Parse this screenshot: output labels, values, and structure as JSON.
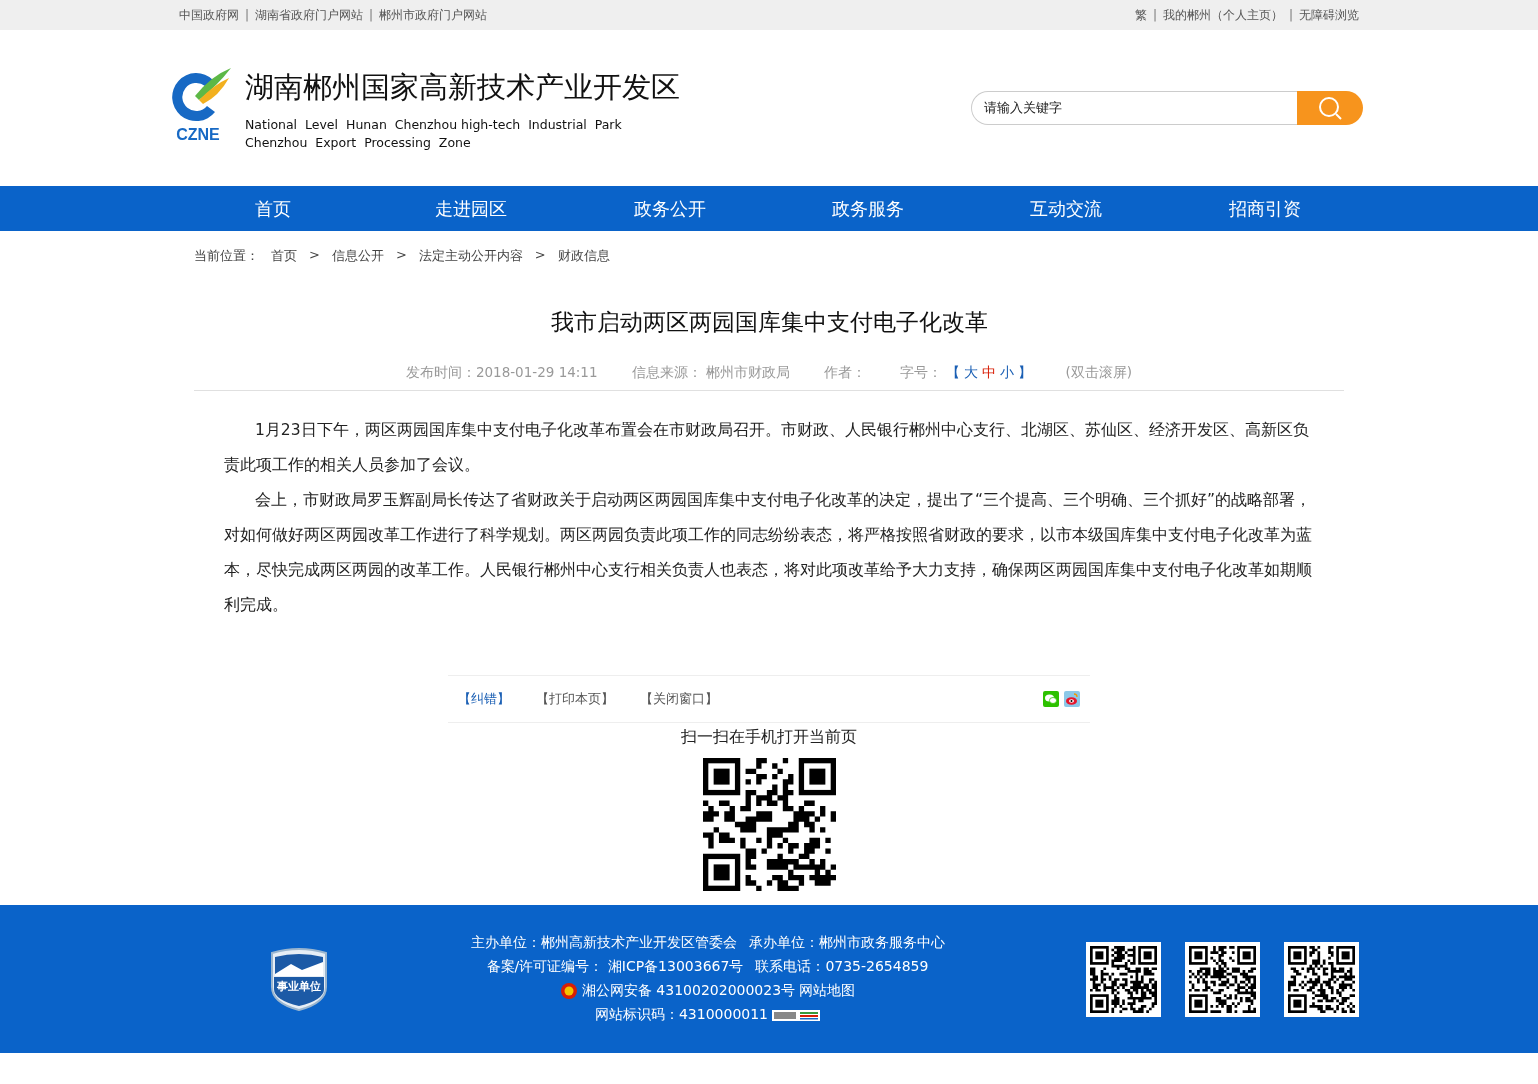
{
  "top_bar": {
    "separator": "|",
    "left_links": [
      "中国政府网",
      "湖南省政府门户网站",
      "郴州市政府门户网站"
    ],
    "right_links": [
      "繁",
      "我的郴州（个人主页）",
      "无障碍浏览"
    ]
  },
  "header": {
    "logo_text": "CZNE",
    "site_title": "湖南郴州国家高新技术产业开发区",
    "subtitle_lines": [
      "National  Level  Hunan  Chenzhou high-tech  Industrial  Park",
      "Chenzhou  Export  Processing  Zone"
    ],
    "search": {
      "placeholder": "请输入关键字"
    }
  },
  "nav": [
    "首页",
    "走进园区",
    "政务公开",
    "政务服务",
    "互动交流",
    "招商引资"
  ],
  "breadcrumb": {
    "label": "当前位置：",
    "separator": ">",
    "items": [
      "首页",
      "信息公开",
      "法定主动公开内容",
      "财政信息"
    ]
  },
  "article": {
    "title": "我市启动两区两园国库集中支付电子化改革",
    "meta": {
      "published": "发布时间：2018-01-29 14:11",
      "source_label": "信息来源：",
      "source": "郴州市财政局",
      "author_label": "作者：",
      "font_size_label": "字号：",
      "open_bracket": "【",
      "sizes": [
        {
          "label": "大",
          "color": "#1a5fb4"
        },
        {
          "label": "中",
          "color": "#d81e06"
        },
        {
          "label": "小",
          "color": "#1a5fb4"
        }
      ],
      "close_bracket": "】",
      "fullscreen": "(双击滚屏)"
    },
    "paragraphs": [
      "1月23日下午，两区两园国库集中支付电子化改革布置会在市财政局召开。市财政、人民银行郴州中心支行、北湖区、苏仙区、经济开发区、高新区负责此项工作的相关人员参加了会议。",
      "会上，市财政局罗玉辉副局长传达了省财政关于启动两区两园国库集中支付电子化改革的决定，提出了“三个提高、三个明确、三个抓好”的战略部署，对如何做好两区两园改革工作进行了科学规划。两区两园负责此项工作的同志纷纷表态，将严格按照省财政的要求，以市本级国库集中支付电子化改革为蓝本，尽快完成两区两园的改革工作。人民银行郴州中心支行相关负责人也表态，将对此项改革给予大力支持，确保两区两园国库集中支付电子化改革如期顺利完成。"
    ]
  },
  "tools": [
    {
      "label": "【纠错】",
      "color": "#1a5fb4"
    },
    {
      "label": "【打印本页】",
      "color": "#555555"
    },
    {
      "label": "【关闭窗口】",
      "color": "#555555"
    }
  ],
  "qr_caption": "扫一扫在手机打开当前页",
  "footer": {
    "badge_text": "事业单位",
    "lines": [
      [
        "主办单位：郴州高新技术产业开发区管委会",
        "承办单位：郴州市政务服务中心"
      ],
      [
        "备案/许可证编号： 湘ICP备13003667号",
        "联系电话：0735-2654859"
      ],
      [
        "湘公网安备 43100202000023号",
        "网站地图"
      ],
      [
        "网站标识码：4310000011"
      ]
    ]
  }
}
